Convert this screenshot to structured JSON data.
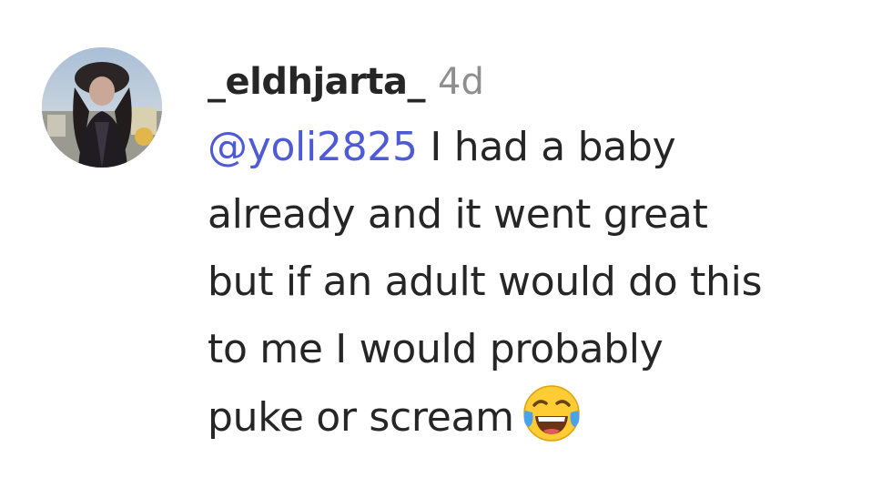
{
  "comment": {
    "avatar_icon": "profile-photo-avatar",
    "username": "_eldhjarta_",
    "timestamp": "4d",
    "mention": "@yoli2825",
    "text_lines": [
      " I had a baby",
      "already and it went great",
      "but if an adult would do this",
      "to me I would probably",
      "puke or scream"
    ],
    "emoji_icon": "face-with-tears-of-joy-icon",
    "colors": {
      "mention": "#4f5bd5",
      "timestamp": "#8e8e8e",
      "text": "#262626"
    }
  }
}
